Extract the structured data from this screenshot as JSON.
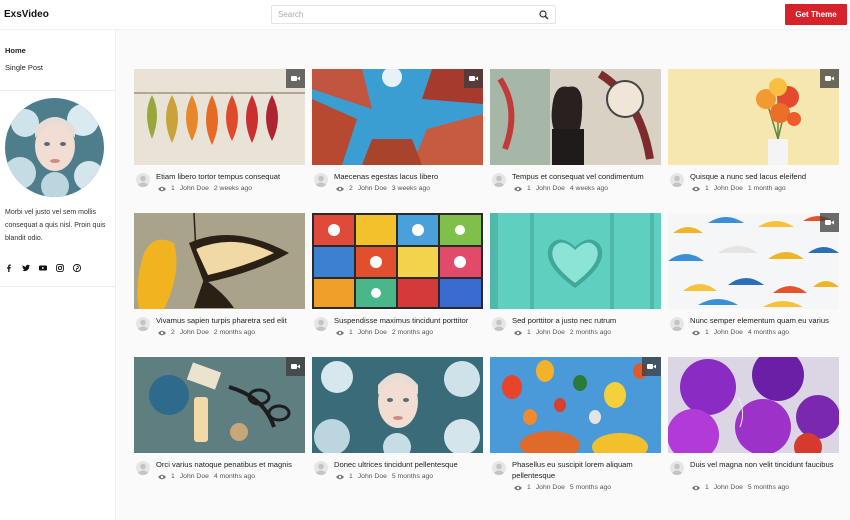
{
  "header": {
    "brand": "ExsVideo",
    "search_placeholder": "Search",
    "cta_label": "Get Theme",
    "accent": "#d6232b"
  },
  "sidebar": {
    "nav": [
      {
        "label": "Home"
      },
      {
        "label": "Single Post"
      }
    ],
    "bio": "Morbi vel justo vel sem mollis consequat a quis nisl. Proin quis blandit odio.",
    "socials": [
      "facebook-icon",
      "twitter-icon",
      "youtube-icon",
      "instagram-icon",
      "pinterest-icon"
    ]
  },
  "posts": [
    {
      "title": "Etiam libero tortor tempus consequat",
      "views": "1",
      "author": "John Doe",
      "date": "2 weeks ago",
      "video": true
    },
    {
      "title": "Maecenas egestas lacus libero",
      "views": "2",
      "author": "John Doe",
      "date": "3 weeks ago",
      "video": true
    },
    {
      "title": "Tempus et consequat vel condimentum",
      "views": "1",
      "author": "John Doe",
      "date": "4 weeks ago",
      "video": false
    },
    {
      "title": "Quisque a nunc sed lacus eleifend",
      "views": "1",
      "author": "John Doe",
      "date": "1 month ago",
      "video": true
    },
    {
      "title": "Vivamus sapien turpis pharetra sed elit",
      "views": "2",
      "author": "John Doe",
      "date": "2 months ago",
      "video": false
    },
    {
      "title": "Suspendisse maximus tincidunt porttitor",
      "views": "1",
      "author": "John Doe",
      "date": "2 months ago",
      "video": false
    },
    {
      "title": "Sed porttitor a justo nec rutrum",
      "views": "1",
      "author": "John Doe",
      "date": "2 months ago",
      "video": false
    },
    {
      "title": "Nunc semper elementum quam eu varius",
      "views": "1",
      "author": "John Doe",
      "date": "4 months ago",
      "video": true
    },
    {
      "title": "Orci varius natoque penatibus et magnis",
      "views": "1",
      "author": "John Doe",
      "date": "4 months ago",
      "video": true
    },
    {
      "title": "Donec ultrices tincidunt pellentesque",
      "views": "1",
      "author": "John Doe",
      "date": "5 months ago",
      "video": false
    },
    {
      "title": "Phasellus eu suscipit lorem aliquam pellentesque",
      "views": "1",
      "author": "John Doe",
      "date": "5 months ago",
      "video": true
    },
    {
      "title": "Duis vel magna non velit tincidunt faucibus",
      "views": "1",
      "author": "John Doe",
      "date": "5 months ago",
      "video": false
    }
  ]
}
